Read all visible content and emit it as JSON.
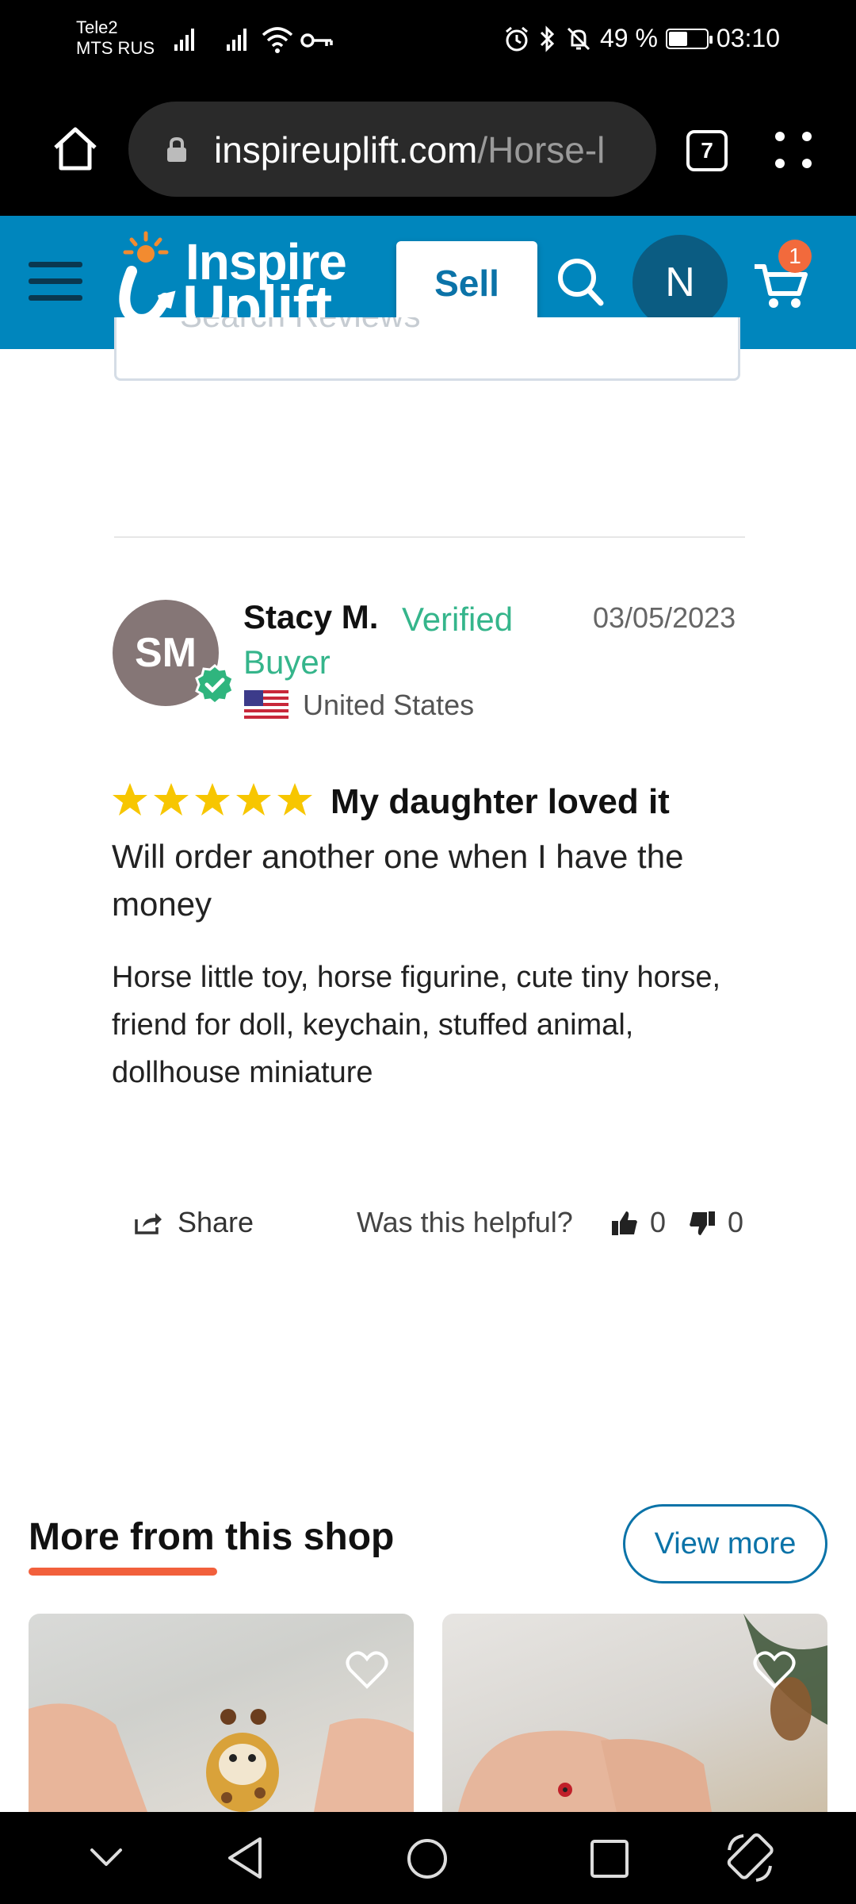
{
  "status_bar": {
    "carrier_1": "Tele2",
    "carrier_2": "MTS RUS",
    "battery_text": "49 %",
    "battery_level": 0.49,
    "time": "03:10"
  },
  "browser": {
    "url_domain": "inspireuplift.com",
    "url_path": "/Horse-l",
    "tab_count": "7"
  },
  "site_header": {
    "logo_line1": "Inspire",
    "logo_line2": "Uplift",
    "sell_label": "Sell",
    "user_initial": "N",
    "cart_count": "1",
    "brand_color": "#0086bd",
    "accent_color": "#f26a3c"
  },
  "reviews": {
    "search_placeholder": "Search Reviews"
  },
  "review": {
    "initials": "SM",
    "name": "Stacy M.",
    "verified": "Verified Buyer",
    "date": "03/05/2023",
    "country": "United States",
    "rating": 5,
    "title": "My daughter loved it",
    "body": "Will order another one when I have the money",
    "tags": "Horse little toy, horse figurine, cute tiny horse, friend for doll, keychain, stuffed animal, dollhouse miniature",
    "share_label": "Share",
    "helpful_label": "Was this helpful?",
    "helpful_up": "0",
    "helpful_down": "0"
  },
  "more_from_shop": {
    "title": "More from this shop",
    "view_more_label": "View more"
  }
}
